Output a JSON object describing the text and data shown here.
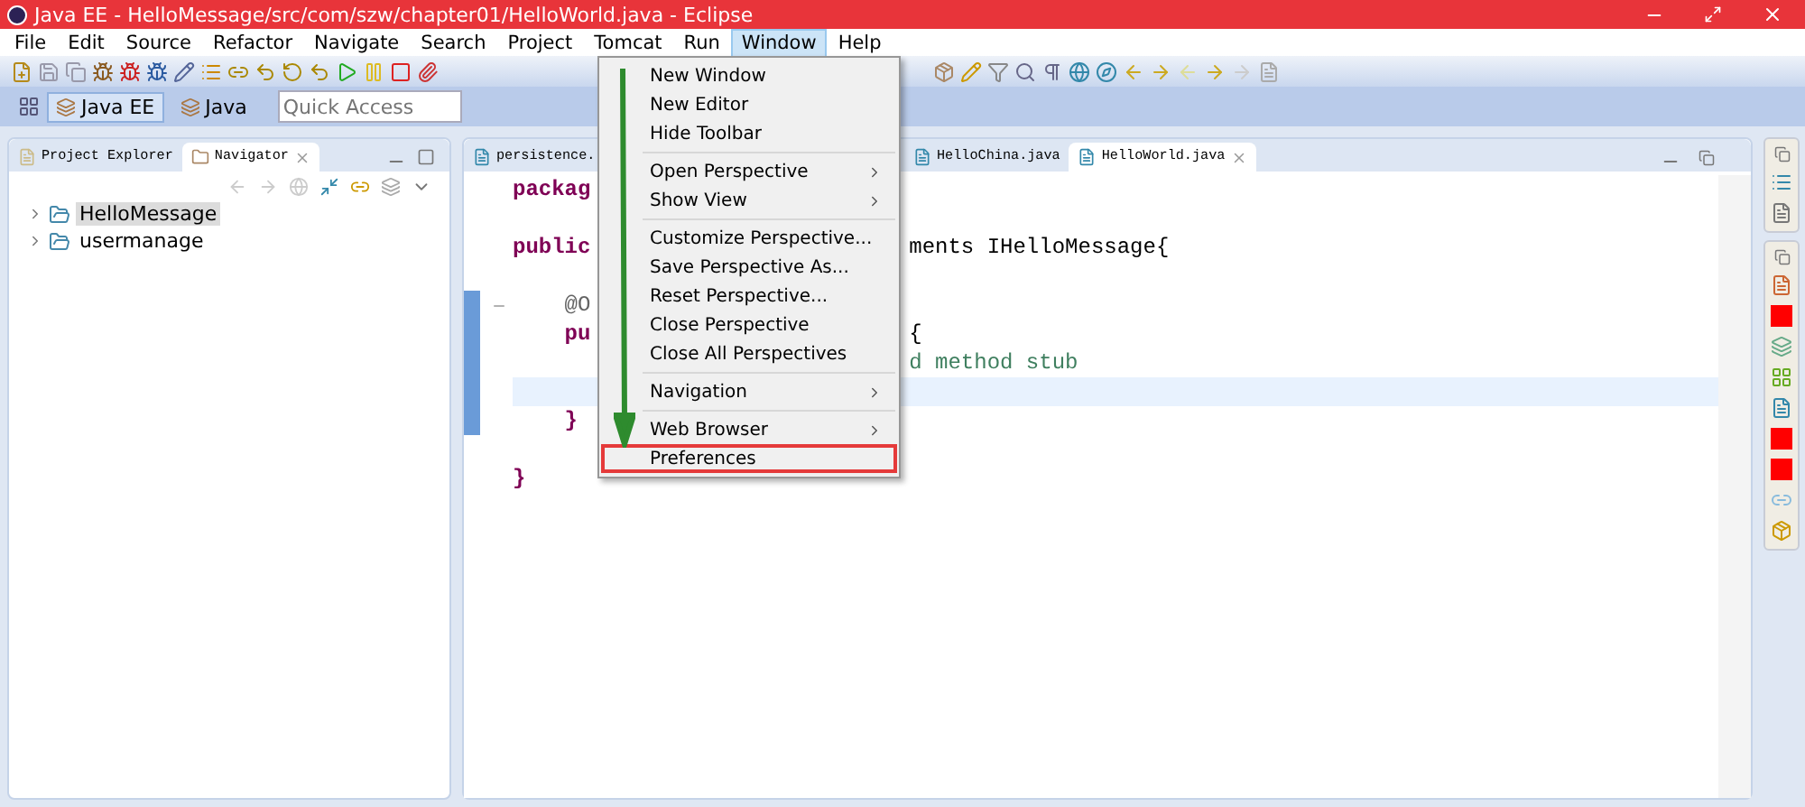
{
  "window": {
    "title": "Java EE - HelloMessage/src/com/szw/chapter01/HelloWorld.java - Eclipse"
  },
  "menu_bar": [
    {
      "label": "File",
      "selected": false
    },
    {
      "label": "Edit",
      "selected": false
    },
    {
      "label": "Source",
      "selected": false
    },
    {
      "label": "Refactor",
      "selected": false
    },
    {
      "label": "Navigate",
      "selected": false
    },
    {
      "label": "Search",
      "selected": false
    },
    {
      "label": "Project",
      "selected": false
    },
    {
      "label": "Tomcat",
      "selected": false
    },
    {
      "label": "Run",
      "selected": false
    },
    {
      "label": "Window",
      "selected": true
    },
    {
      "label": "Help",
      "selected": false
    }
  ],
  "perspectives": [
    {
      "label": "Java EE",
      "selected": true
    },
    {
      "label": "Java",
      "selected": false
    }
  ],
  "quick_access": {
    "placeholder": "Quick Access"
  },
  "left_panel": {
    "tabs": [
      {
        "label": "Project Explorer",
        "selected": false
      },
      {
        "label": "Navigator",
        "selected": true
      }
    ],
    "tree": [
      {
        "label": "HelloMessage",
        "selected": true,
        "expanded": false
      },
      {
        "label": "usermanage",
        "selected": false,
        "expanded": false
      }
    ]
  },
  "editor": {
    "tabs": [
      {
        "label": "persistence.",
        "selected": false
      },
      {
        "label": "HelloChina.java",
        "selected": false
      },
      {
        "label": "HelloWorld.java",
        "selected": true
      }
    ],
    "lines": [
      {
        "left": "packag",
        "indent": false,
        "current": false
      },
      {
        "current": false
      },
      {
        "left": "public",
        "right": "ments IHelloMessage{",
        "indent": false,
        "current": false
      },
      {
        "current": false
      },
      {
        "left": "@O",
        "indent": true,
        "kind": "annotation",
        "current": false
      },
      {
        "left": "pu",
        "right": "{",
        "indent": true,
        "current": false
      },
      {
        "right": "d method stub",
        "kind": "comment",
        "current": false
      },
      {
        "current": true
      },
      {
        "left": "}",
        "indent": true,
        "current": false
      },
      {
        "current": false
      },
      {
        "left": "}",
        "indent": false,
        "current": false
      }
    ]
  },
  "window_menu": [
    [
      {
        "label": "New Window",
        "submenu": false,
        "highlighted": false
      },
      {
        "label": "New Editor",
        "submenu": false,
        "highlighted": false
      },
      {
        "label": "Hide Toolbar",
        "submenu": false,
        "highlighted": false
      }
    ],
    [
      {
        "label": "Open Perspective",
        "submenu": true,
        "highlighted": false
      },
      {
        "label": "Show View",
        "submenu": true,
        "highlighted": false
      }
    ],
    [
      {
        "label": "Customize Perspective...",
        "submenu": false,
        "highlighted": false
      },
      {
        "label": "Save Perspective As...",
        "submenu": false,
        "highlighted": false
      },
      {
        "label": "Reset Perspective...",
        "submenu": false,
        "highlighted": false
      },
      {
        "label": "Close Perspective",
        "submenu": false,
        "highlighted": false
      },
      {
        "label": "Close All Perspectives",
        "submenu": false,
        "highlighted": false
      }
    ],
    [
      {
        "label": "Navigation",
        "submenu": true,
        "highlighted": false
      }
    ],
    [
      {
        "label": "Web Browser",
        "submenu": true,
        "highlighted": false
      },
      {
        "label": "Preferences",
        "submenu": false,
        "highlighted": true
      }
    ]
  ]
}
